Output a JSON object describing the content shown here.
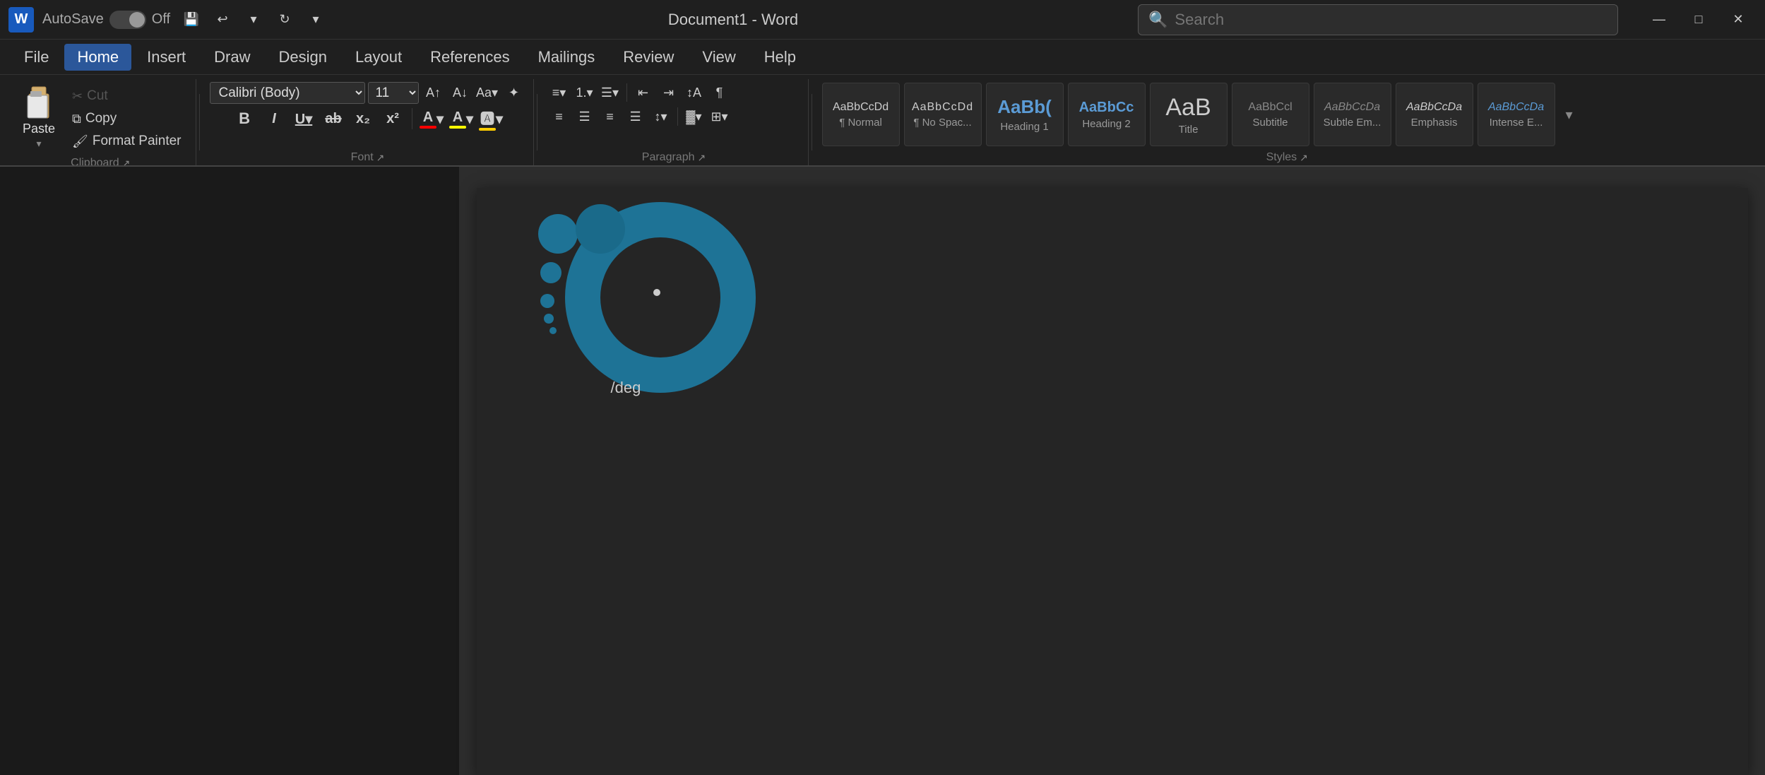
{
  "titlebar": {
    "logo": "W",
    "autosave_label": "AutoSave",
    "toggle_state": "Off",
    "doc_title": "Document1 - Word",
    "search_placeholder": "Search",
    "save_icon": "💾",
    "undo_icon": "↩",
    "redo_icon": "↻",
    "more_icon": "⌄"
  },
  "menubar": {
    "items": [
      "File",
      "Home",
      "Insert",
      "Draw",
      "Design",
      "Layout",
      "References",
      "Mailings",
      "Review",
      "View",
      "Help"
    ],
    "active": "Home"
  },
  "ribbon": {
    "clipboard": {
      "paste_label": "Paste",
      "cut_label": "Cut",
      "copy_label": "Copy",
      "format_painter_label": "Format Painter"
    },
    "font": {
      "font_name": "Calibri (Body)",
      "font_size": "11",
      "bold_label": "B",
      "italic_label": "I",
      "underline_label": "U",
      "strikethrough_label": "ab",
      "subscript_label": "x₂",
      "superscript_label": "x²"
    },
    "paragraph": {
      "label": "Paragraph"
    },
    "styles": {
      "label": "Styles",
      "items": [
        {
          "id": "normal",
          "preview": "AaBbCcDd",
          "label": "¶ Normal"
        },
        {
          "id": "no-spacing",
          "preview": "AaBbCcDd",
          "label": "¶ No Spac..."
        },
        {
          "id": "heading1",
          "preview": "AaBb(",
          "label": "Heading 1"
        },
        {
          "id": "heading2",
          "preview": "AaBbCc",
          "label": "Heading 2"
        },
        {
          "id": "title",
          "preview": "AaB",
          "label": "Title"
        },
        {
          "id": "subtitle",
          "preview": "AaBbCcl",
          "label": "Subtitle"
        },
        {
          "id": "subtle-em",
          "preview": "AaBbCcDa",
          "label": "Subtle Em..."
        },
        {
          "id": "emphasis",
          "preview": "AaBbCcDa",
          "label": "Emphasis"
        },
        {
          "id": "intense",
          "preview": "AaBbCcDa",
          "label": "Intense E..."
        }
      ]
    }
  },
  "document": {
    "text": "/deg"
  },
  "colors": {
    "teal_dark": "#1e7396",
    "teal_medium": "#2196a8",
    "teal_light": "#3dbccc",
    "accent_blue": "#185abd",
    "ribbon_bg": "#1f1f1f",
    "doc_bg": "#252525"
  }
}
